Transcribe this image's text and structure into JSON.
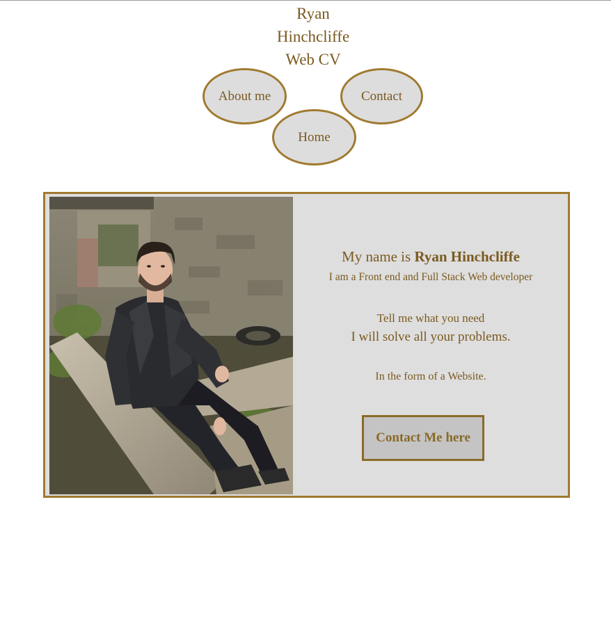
{
  "header": {
    "title_lines": [
      "Ryan",
      "Hinchcliffe",
      "Web CV"
    ]
  },
  "nav": {
    "about": "About me",
    "contact": "Contact",
    "home": "Home"
  },
  "profile": {
    "intro_prefix": "My name is ",
    "name": "Ryan Hinchcliffe",
    "role": "I am a Front end and Full Stack Web developer",
    "need": "Tell me what you need",
    "solve": "I will solve all your problems.",
    "form": "In the form of a Website.",
    "cta_label": "Contact Me here",
    "photo_alt": "Ryan Hinchcliffe"
  },
  "colors": {
    "accent": "#a07a30",
    "text": "#7a5a20",
    "card_bg": "#dedede",
    "nav_bg": "#dddddd",
    "button_bg": "#c4c4c4"
  }
}
